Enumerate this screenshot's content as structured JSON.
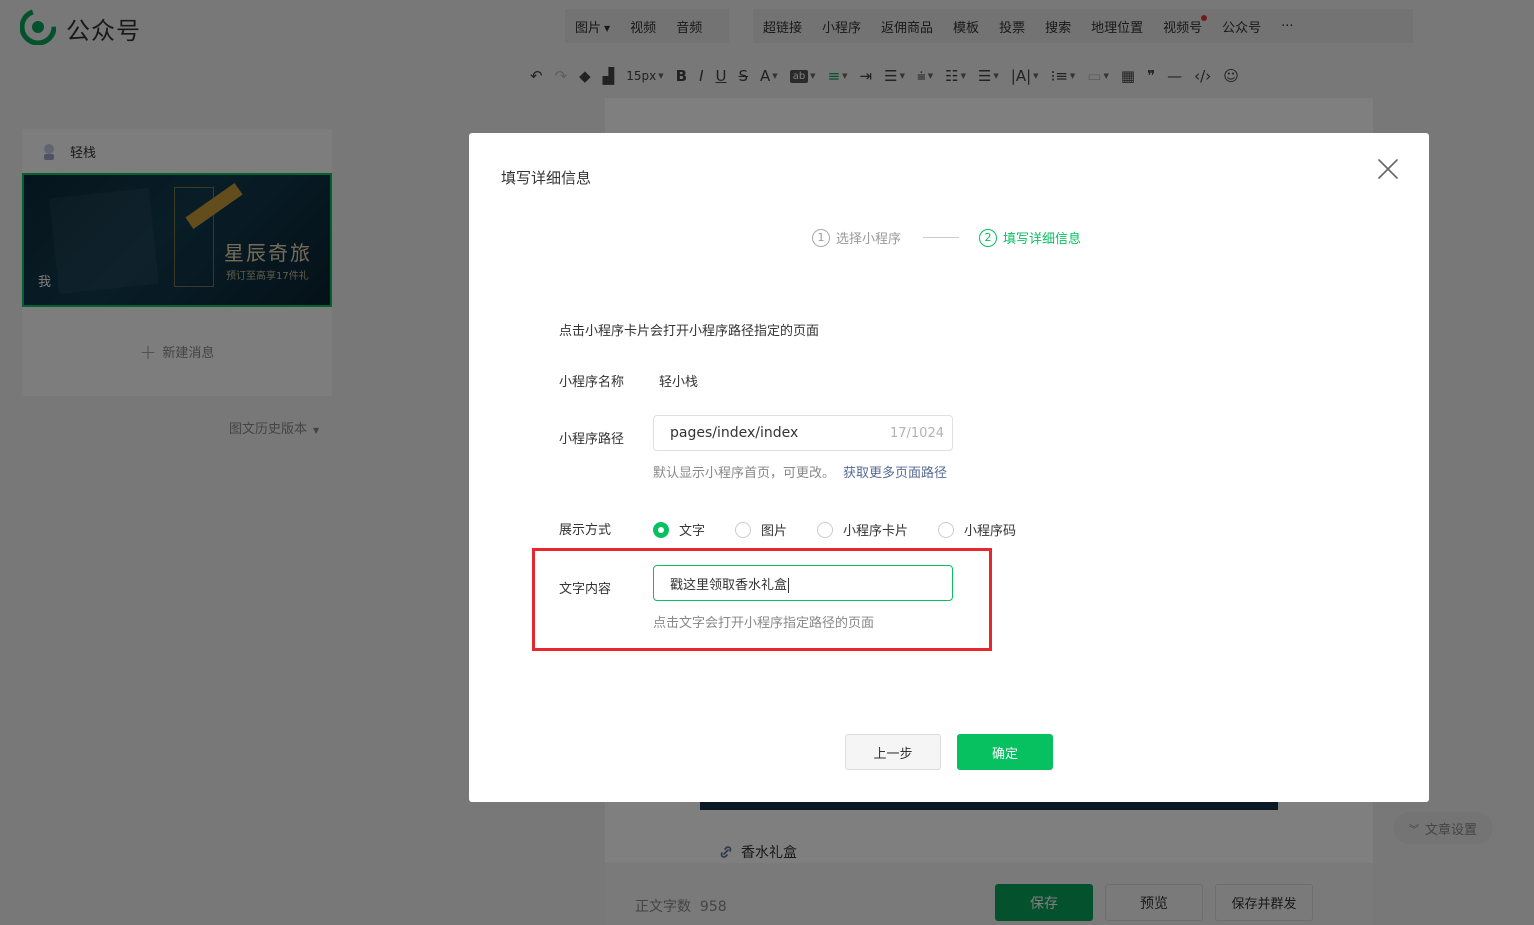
{
  "app": {
    "logo_text": "公众号"
  },
  "nav": {
    "group1": [
      {
        "label": "图片",
        "caret": true
      },
      {
        "label": "视频",
        "caret": false
      },
      {
        "label": "音频",
        "caret": false
      }
    ],
    "group2": [
      {
        "label": "超链接"
      },
      {
        "label": "小程序"
      },
      {
        "label": "返佣商品"
      },
      {
        "label": "模板"
      },
      {
        "label": "投票"
      },
      {
        "label": "搜索"
      },
      {
        "label": "地理位置"
      },
      {
        "label": "视频号"
      },
      {
        "label": "公众号"
      },
      {
        "label": "···"
      }
    ]
  },
  "toolbar": {
    "font_size": "15px"
  },
  "left_panel": {
    "account_name": "轻栈",
    "cover_title": "星辰奇旅",
    "cover_subtitle": "预订至高享17件礼",
    "cover_badge": "我",
    "new_message": "新建消息",
    "history": "图文历史版本"
  },
  "editor": {
    "mini_link_text": "香水礼盒",
    "word_count_label": "正文字数",
    "word_count": "958",
    "save": "保存",
    "preview": "预览",
    "save_publish": "保存并群发",
    "article_settings": "文章设置"
  },
  "modal": {
    "title": "填写详细信息",
    "steps": [
      {
        "num": "1",
        "label": "选择小程序",
        "active": false
      },
      {
        "num": "2",
        "label": "填写详细信息",
        "active": true
      }
    ],
    "hint": "点击小程序卡片会打开小程序路径指定的页面",
    "name_label": "小程序名称",
    "name_value": "轻小栈",
    "path_label": "小程序路径",
    "path_value": "pages/index/index",
    "path_count": "17/1024",
    "path_tip": "默认显示小程序首页，可更改。",
    "path_link": "获取更多页面路径",
    "display_label": "展示方式",
    "display_options": [
      {
        "label": "文字",
        "selected": true
      },
      {
        "label": "图片",
        "selected": false
      },
      {
        "label": "小程序卡片",
        "selected": false
      },
      {
        "label": "小程序码",
        "selected": false
      }
    ],
    "text_label": "文字内容",
    "text_value": "戳这里领取香水礼盒",
    "text_tip": "点击文字会打开小程序指定路径的页面",
    "prev_button": "上一步",
    "ok_button": "确定"
  },
  "colors": {
    "brand_green": "#07c160",
    "highlight_red": "#e8262e",
    "link_blue": "#576b95"
  }
}
